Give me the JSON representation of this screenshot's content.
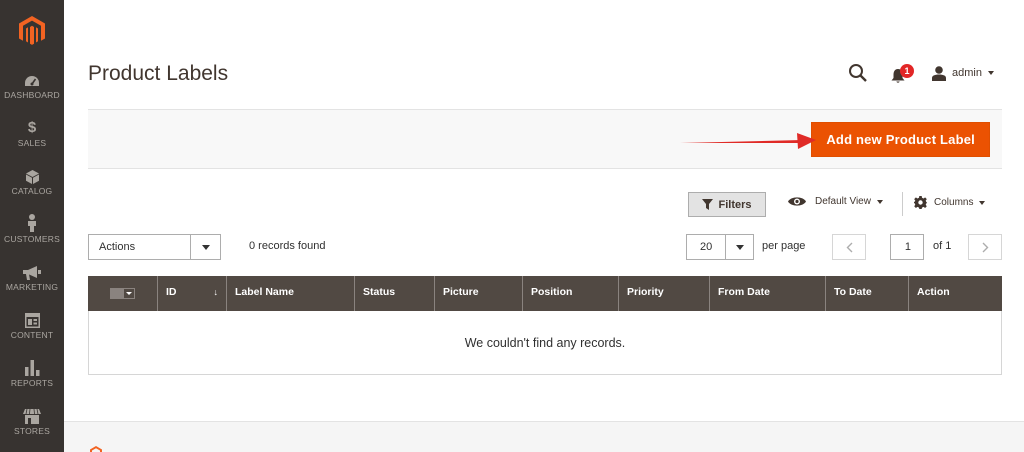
{
  "sidebar": {
    "items": [
      {
        "label": "DASHBOARD",
        "icon": "speedometer-icon"
      },
      {
        "label": "SALES",
        "icon": "dollar-icon"
      },
      {
        "label": "CATALOG",
        "icon": "cube-icon"
      },
      {
        "label": "CUSTOMERS",
        "icon": "person-icon"
      },
      {
        "label": "MARKETING",
        "icon": "megaphone-icon"
      },
      {
        "label": "CONTENT",
        "icon": "layout-icon"
      },
      {
        "label": "REPORTS",
        "icon": "bar-chart-icon"
      },
      {
        "label": "STORES",
        "icon": "storefront-icon"
      }
    ]
  },
  "header": {
    "title": "Product Labels",
    "notifications_count": "1",
    "user_name": "admin"
  },
  "action_bar": {
    "add_button_label": "Add new Product Label"
  },
  "toolbar": {
    "filters_label": "Filters",
    "view_label": "Default View",
    "columns_label": "Columns",
    "actions_label": "Actions",
    "records_found": "0 records found",
    "per_page_value": "20",
    "per_page_label": "per page",
    "current_page": "1",
    "total_pages_label": "of 1"
  },
  "grid": {
    "columns": [
      "ID",
      "Label Name",
      "Status",
      "Picture",
      "Position",
      "Priority",
      "From Date",
      "To Date",
      "Action"
    ],
    "sort_indicator": "↓",
    "empty_message": "We couldn't find any records."
  },
  "colors": {
    "sidebar_bg": "#373330",
    "accent": "#eb5202",
    "grid_header_bg": "#514943",
    "annotation_arrow": "#e02b27",
    "badge": "#e22626"
  }
}
